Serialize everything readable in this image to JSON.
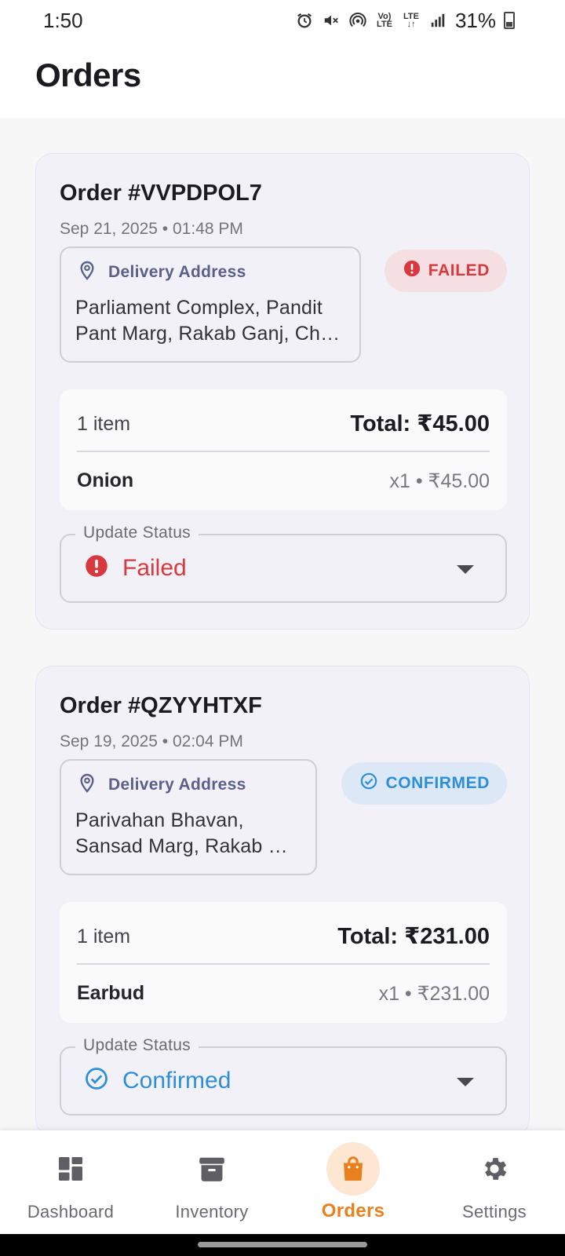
{
  "status_bar": {
    "time": "1:50",
    "volte_top": "Vo)",
    "volte_bottom": "LTE",
    "lte_top": "LTE",
    "lte_bottom": "↓↑",
    "battery": "31%",
    "icons": [
      "alarm-icon",
      "mute-icon",
      "hotspot-icon",
      "volte-icon",
      "lte-icon",
      "signal-icon",
      "battery-icon"
    ]
  },
  "header": {
    "title": "Orders"
  },
  "orders": [
    {
      "title": "Order #VVPDPOL7",
      "date": "Sep 21, 2025 • 01:48 PM",
      "address_label": "Delivery Address",
      "address": "Parliament Complex, Pandit Pant Marg, Rakab Ganj, Ch…",
      "badge": "FAILED",
      "item_count": "1 item",
      "total": "Total: ₹45.00",
      "item_name": "Onion",
      "item_meta": "x1 • ₹45.00",
      "select_label": "Update Status",
      "select_value": "Failed",
      "status_color": "#d8393f"
    },
    {
      "title": "Order #QZYYHTXF",
      "date": "Sep 19, 2025 • 02:04 PM",
      "address_label": "Delivery Address",
      "address": "Parivahan Bhavan, Sansad Marg, Rakab …",
      "badge": "CONFIRMED",
      "item_count": "1 item",
      "total": "Total: ₹231.00",
      "item_name": "Earbud",
      "item_meta": "x1 • ₹231.00",
      "select_label": "Update Status",
      "select_value": "Confirmed",
      "status_color": "#2e8fd8"
    }
  ],
  "nav": {
    "items": [
      {
        "label": "Dashboard",
        "icon": "dashboard-icon"
      },
      {
        "label": "Inventory",
        "icon": "archive-icon"
      },
      {
        "label": "Orders",
        "icon": "shopping-bag-icon",
        "active": true
      },
      {
        "label": "Settings",
        "icon": "gear-icon"
      }
    ],
    "accent": "#e8801e"
  }
}
